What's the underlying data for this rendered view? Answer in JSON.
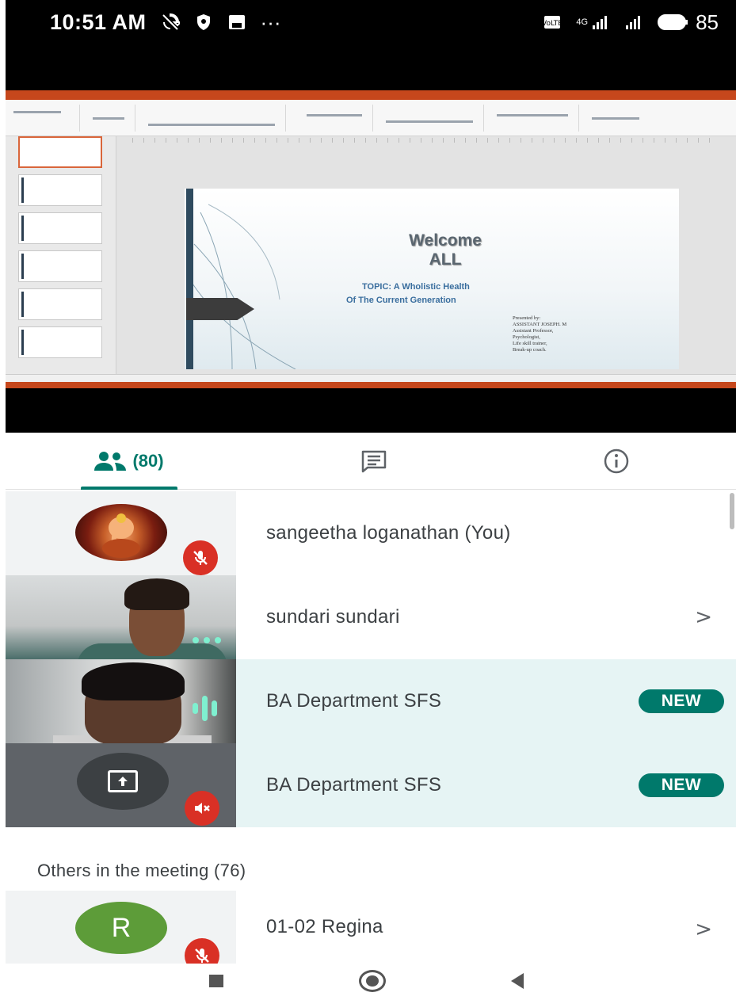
{
  "status_bar": {
    "time": "10:51 AM",
    "dots": "···",
    "network_label": "4G",
    "battery": "85"
  },
  "presentation": {
    "slide_title_line1": "Welcome",
    "slide_title_line2": "ALL",
    "topic_line1": "TOPIC: A Wholistic Health",
    "topic_line2": "Of The Current Generation",
    "credits": [
      "Presented by:",
      "ASSISTANT JOSEPH. M",
      "Assistant Professor,",
      "Psychologist,",
      "Life skill trainer,",
      "Break-up coach."
    ]
  },
  "tabs": {
    "people_count": "(80)"
  },
  "participants": [
    {
      "name": "sangeetha loganathan (You)",
      "muted": true
    },
    {
      "name": "sundari sundari",
      "muted": false
    },
    {
      "name": "BA Department SFS",
      "badge": "NEW"
    },
    {
      "name": "BA Department SFS",
      "badge": "NEW",
      "muted": true
    }
  ],
  "others_header": "Others in the meeting (76)",
  "others": [
    {
      "initial": "R",
      "name": "01-02 Regina",
      "avatar_color": "#5d9c39",
      "muted": true
    }
  ],
  "colors": {
    "accent": "#00796b",
    "mute_red": "#d93025",
    "highlight_row": "#e6f4f4"
  }
}
